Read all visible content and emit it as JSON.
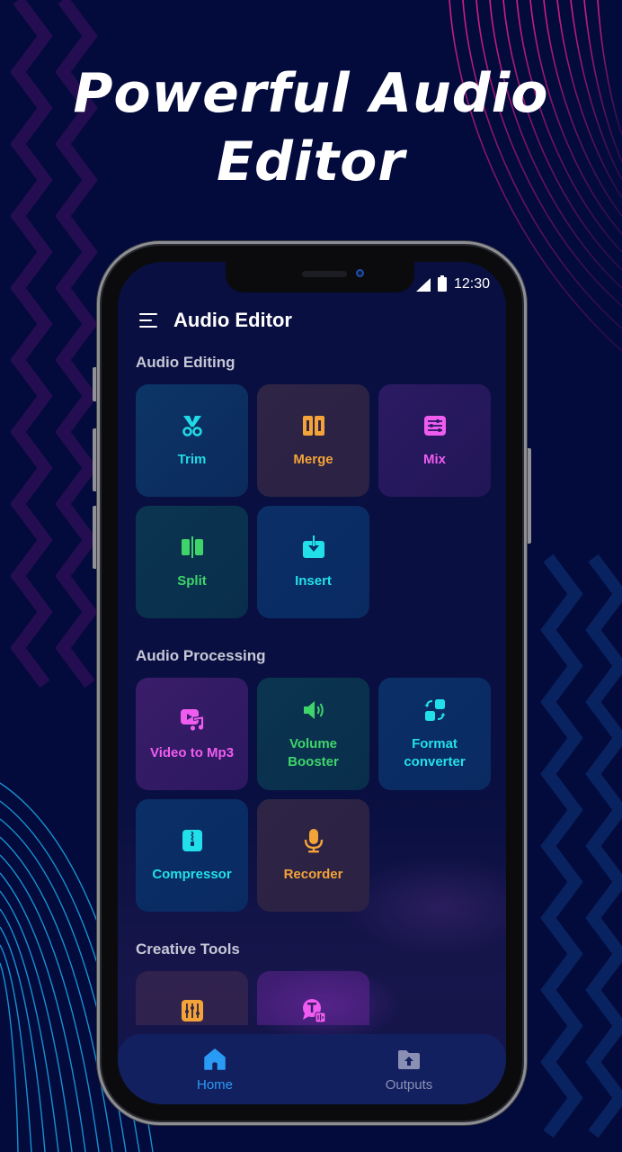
{
  "headline": {
    "line1": "Powerful Audio",
    "line2": "Editor"
  },
  "status_bar": {
    "time": "12:30",
    "icons": [
      "signal-icon",
      "battery-icon"
    ]
  },
  "app_bar": {
    "menu_icon": "hamburger-menu-icon",
    "title": "Audio Editor"
  },
  "sections": [
    {
      "title": "Audio Editing",
      "tools": [
        {
          "label": "Trim",
          "icon": "scissors-icon",
          "color": "#22d9e6"
        },
        {
          "label": "Merge",
          "icon": "merge-icon",
          "color": "#f4a338"
        },
        {
          "label": "Mix",
          "icon": "mixer-icon",
          "color": "#f05cf0"
        },
        {
          "label": "Split",
          "icon": "split-icon",
          "color": "#3fd46a"
        },
        {
          "label": "Insert",
          "icon": "insert-icon",
          "color": "#22e0ea"
        }
      ]
    },
    {
      "title": "Audio Processing",
      "tools": [
        {
          "label": "Video to Mp3",
          "icon": "video-music-icon",
          "color": "#f05cf0"
        },
        {
          "label": "Volume Booster",
          "label_line1": "Volume",
          "label_line2": "Booster",
          "icon": "speaker-icon",
          "color": "#3fd46a"
        },
        {
          "label": "Format converter",
          "label_line1": "Format",
          "label_line2": "converter",
          "icon": "convert-icon",
          "color": "#22e0ea"
        },
        {
          "label": "Compressor",
          "icon": "zip-icon",
          "color": "#22e0ea"
        },
        {
          "label": "Recorder",
          "icon": "microphone-icon",
          "color": "#f4a338"
        }
      ]
    },
    {
      "title": "Creative Tools",
      "tools": [
        {
          "label": "",
          "icon": "equalizer-icon",
          "color": "#f4a338"
        },
        {
          "label": "",
          "icon": "text-to-speech-icon",
          "color": "#f05cf0"
        }
      ]
    }
  ],
  "bottom_nav": [
    {
      "label": "Home",
      "icon": "home-icon",
      "active": true,
      "color": "#2a9bf5"
    },
    {
      "label": "Outputs",
      "icon": "folder-upload-icon",
      "active": false,
      "color": "#8a8fb3"
    }
  ],
  "colors": {
    "background": "#030a3c",
    "screen": "#090f40",
    "section_title": "#c6c8d6",
    "nav_bar": "#132060"
  }
}
